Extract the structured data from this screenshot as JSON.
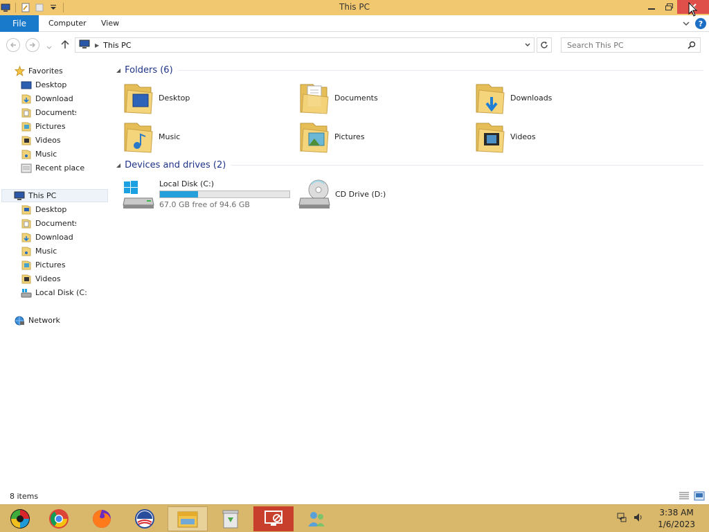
{
  "window": {
    "title": "This PC"
  },
  "ribbon": {
    "file_label": "File",
    "tabs": [
      "Computer",
      "View"
    ]
  },
  "address": {
    "crumb": "This PC"
  },
  "search": {
    "placeholder": "Search This PC"
  },
  "navpane": {
    "favorites_label": "Favorites",
    "favorites": [
      {
        "label": "Desktop",
        "icon": "desktop-icon"
      },
      {
        "label": "Download",
        "icon": "downloads-folder-icon"
      },
      {
        "label": "Documents",
        "icon": "documents-folder-icon"
      },
      {
        "label": "Pictures",
        "icon": "pictures-folder-icon"
      },
      {
        "label": "Videos",
        "icon": "videos-folder-icon"
      },
      {
        "label": "Music",
        "icon": "music-folder-icon"
      },
      {
        "label": "Recent place",
        "icon": "recent-places-icon"
      }
    ],
    "thispc_label": "This PC",
    "thispc": [
      {
        "label": "Desktop",
        "icon": "desktop-folder-icon"
      },
      {
        "label": "Documents",
        "icon": "documents-folder-icon"
      },
      {
        "label": "Download",
        "icon": "downloads-folder-icon"
      },
      {
        "label": "Music",
        "icon": "music-folder-icon"
      },
      {
        "label": "Pictures",
        "icon": "pictures-folder-icon"
      },
      {
        "label": "Videos",
        "icon": "videos-folder-icon"
      },
      {
        "label": "Local Disk (C:",
        "icon": "local-disk-icon"
      }
    ],
    "network_label": "Network"
  },
  "content": {
    "folders_header": "Folders (6)",
    "folders": [
      {
        "name": "Desktop",
        "icon": "desktop-folder-icon"
      },
      {
        "name": "Documents",
        "icon": "documents-folder-icon"
      },
      {
        "name": "Downloads",
        "icon": "downloads-folder-icon"
      },
      {
        "name": "Music",
        "icon": "music-folder-icon"
      },
      {
        "name": "Pictures",
        "icon": "pictures-folder-icon"
      },
      {
        "name": "Videos",
        "icon": "videos-folder-icon"
      }
    ],
    "drives_header": "Devices and drives (2)",
    "drives": [
      {
        "name": "Local Disk (C:)",
        "free_text": "67.0 GB free of 94.6 GB",
        "used_fraction": 0.292,
        "icon": "local-disk-icon"
      },
      {
        "name": "CD Drive (D:)",
        "icon": "cd-drive-icon"
      }
    ]
  },
  "status": {
    "items": "8 items"
  },
  "taskbar": {
    "apps": [
      "start-icon",
      "chrome-icon",
      "firefox-icon",
      "obama-logo-icon",
      "file-explorer-icon",
      "recycle-bin-icon",
      "remote-desktop-icon",
      "people-icon"
    ]
  },
  "clock": {
    "time": "3:38 AM",
    "date": "1/6/2023"
  },
  "colors": {
    "titlebar": "#f1c870",
    "file_tab": "#1979ca",
    "taskbar": "#d9b86c",
    "accent_text": "#1e3287",
    "bar_fill": "#26a0da"
  }
}
